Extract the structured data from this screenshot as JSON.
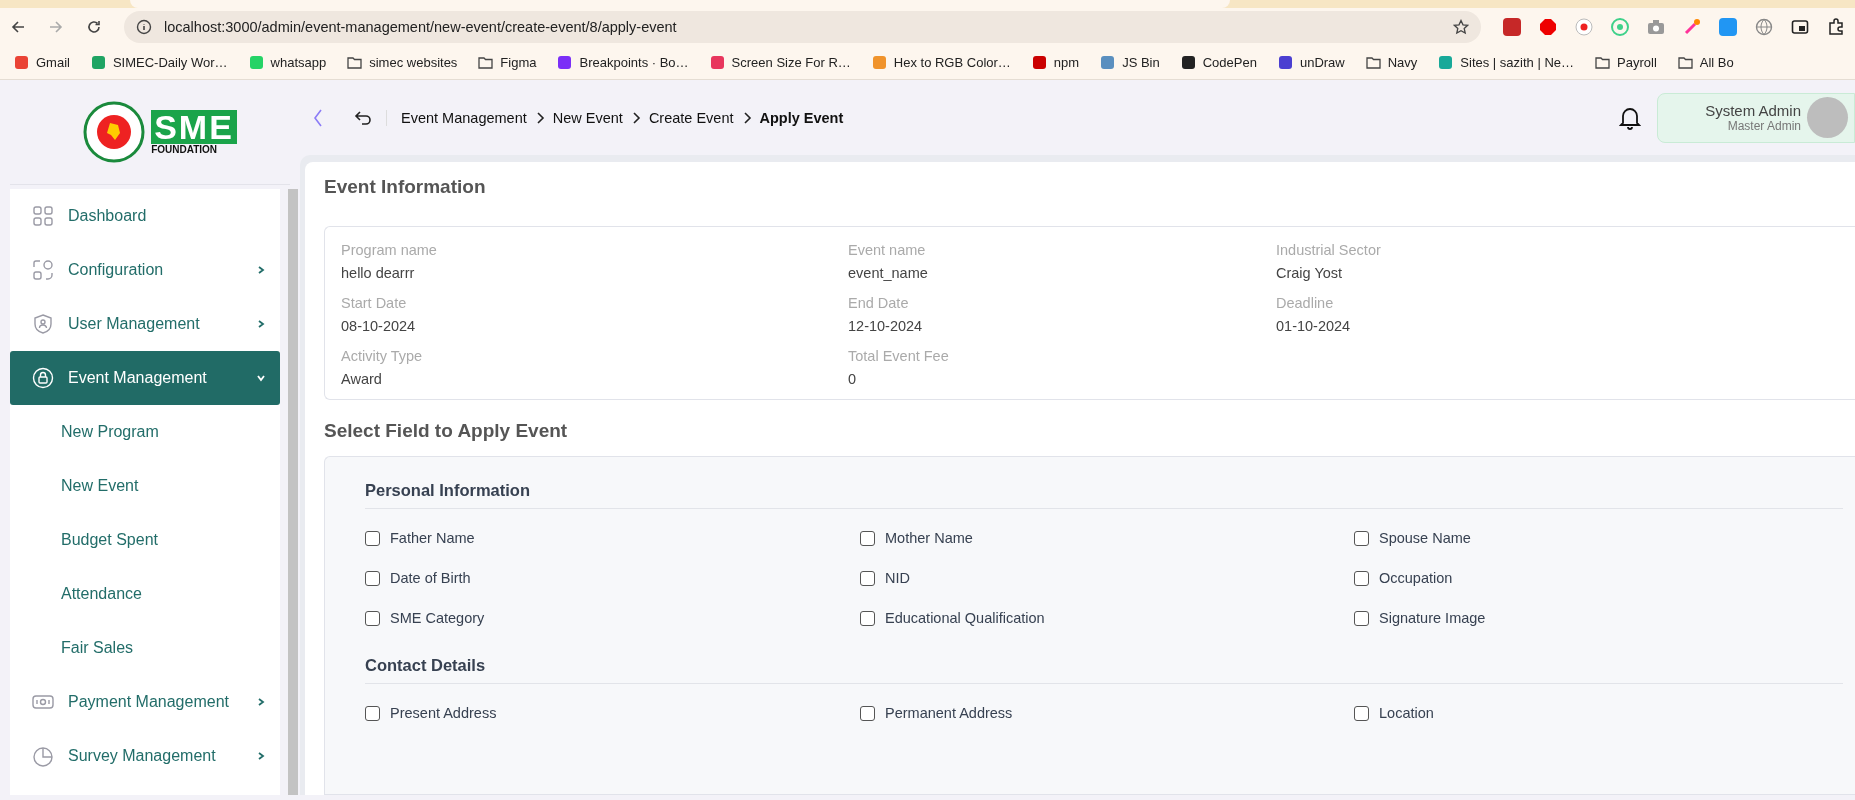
{
  "browser": {
    "url": "localhost:3000/admin/event-management/new-event/create-event/8/apply-event",
    "bookmarks": [
      {
        "label": "Gmail",
        "kind": "site",
        "color": "#ea4335"
      },
      {
        "label": "SIMEC-Daily Wor…",
        "kind": "site",
        "color": "#1fa463"
      },
      {
        "label": "whatsapp",
        "kind": "site",
        "color": "#25d366"
      },
      {
        "label": "simec websites",
        "kind": "folder"
      },
      {
        "label": "Figma",
        "kind": "folder"
      },
      {
        "label": "Breakpoints · Bo…",
        "kind": "site",
        "color": "#7b2ff7"
      },
      {
        "label": "Screen Size For R…",
        "kind": "site",
        "color": "#e8365d"
      },
      {
        "label": "Hex to RGB Color…",
        "kind": "site",
        "color": "#f0932b"
      },
      {
        "label": "npm",
        "kind": "site",
        "color": "#cb0000"
      },
      {
        "label": "JS Bin",
        "kind": "site",
        "color": "#5a8fbf"
      },
      {
        "label": "CodePen",
        "kind": "site",
        "color": "#222222"
      },
      {
        "label": "unDraw",
        "kind": "site",
        "color": "#4b3fd1"
      },
      {
        "label": "Navy",
        "kind": "folder"
      },
      {
        "label": "Sites | sazith | Ne…",
        "kind": "site",
        "color": "#18a999"
      },
      {
        "label": "Payroll",
        "kind": "folder"
      },
      {
        "label": "All Bo",
        "kind": "folder"
      }
    ]
  },
  "logo": {
    "mark": "SME",
    "subtitle": "FOUNDATION"
  },
  "sidebar": {
    "items": [
      {
        "label": "Dashboard",
        "kind": "link",
        "selected": false
      },
      {
        "label": "Configuration",
        "kind": "group",
        "selected": false,
        "expanded": false
      },
      {
        "label": "User Management",
        "kind": "group",
        "selected": false,
        "expanded": false
      },
      {
        "label": "Event Management",
        "kind": "group",
        "selected": true,
        "expanded": true,
        "children": [
          {
            "label": "New Program",
            "selected": false
          },
          {
            "label": "New Event",
            "selected": false
          },
          {
            "label": "Budget Spent",
            "selected": false
          },
          {
            "label": "Attendance",
            "selected": false
          },
          {
            "label": "Fair Sales",
            "selected": false
          }
        ]
      },
      {
        "label": "Payment Management",
        "kind": "group",
        "selected": false,
        "expanded": false
      },
      {
        "label": "Survey Management",
        "kind": "group",
        "selected": false,
        "expanded": false
      }
    ]
  },
  "header": {
    "breadcrumb": [
      {
        "label": "Event Management",
        "current": false
      },
      {
        "label": "New Event",
        "current": false
      },
      {
        "label": "Create Event",
        "current": false
      },
      {
        "label": "Apply Event",
        "current": true
      }
    ],
    "user": {
      "name": "System Admin",
      "role": "Master Admin"
    }
  },
  "event_information": {
    "title": "Event Information",
    "fields": [
      {
        "label": "Program name",
        "value": "hello dearrr"
      },
      {
        "label": "Event name",
        "value": "event_name"
      },
      {
        "label": "Industrial Sector",
        "value": "Craig Yost"
      },
      {
        "label": "Start Date",
        "value": "08-10-2024"
      },
      {
        "label": "End Date",
        "value": "12-10-2024"
      },
      {
        "label": "Deadline",
        "value": "01-10-2024"
      },
      {
        "label": "Activity Type",
        "value": "Award"
      },
      {
        "label": "Total Event Fee",
        "value": "0"
      }
    ]
  },
  "apply_fields": {
    "title": "Select Field to Apply Event",
    "sections": [
      {
        "title": "Personal Information",
        "fields": [
          {
            "label": "Father Name",
            "checked": false
          },
          {
            "label": "Mother Name",
            "checked": false
          },
          {
            "label": "Spouse Name",
            "checked": false
          },
          {
            "label": "Date of Birth",
            "checked": false
          },
          {
            "label": "NID",
            "checked": false
          },
          {
            "label": "Occupation",
            "checked": false
          },
          {
            "label": "SME Category",
            "checked": false
          },
          {
            "label": "Educational Qualification",
            "checked": false
          },
          {
            "label": "Signature Image",
            "checked": false
          }
        ]
      },
      {
        "title": "Contact Details",
        "fields": [
          {
            "label": "Present Address",
            "checked": false
          },
          {
            "label": "Permanent Address",
            "checked": false
          },
          {
            "label": "Location",
            "checked": false
          }
        ]
      }
    ]
  }
}
